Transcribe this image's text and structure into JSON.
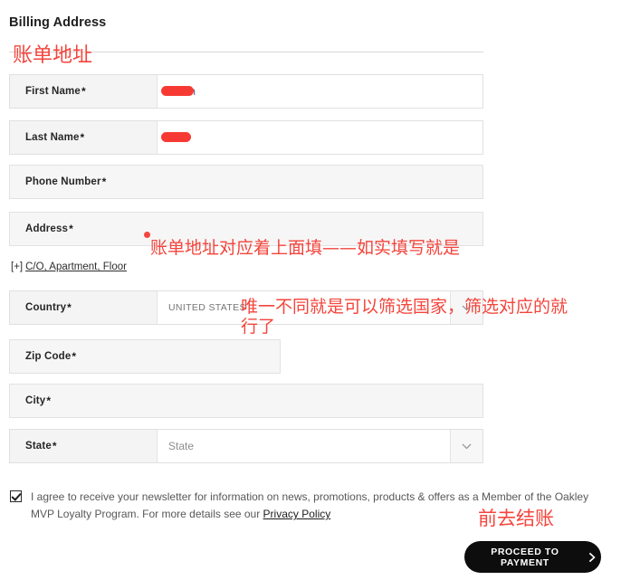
{
  "page": {
    "title": "Billing Address"
  },
  "annotations": [
    {
      "name": "annotation-billing-address",
      "text": "账单地址"
    },
    {
      "name": "annotation-address-note",
      "text": "账单地址对应着上面填——如实填写就是"
    },
    {
      "name": "annotation-country-note",
      "text": "唯一不同就是可以筛选国家，筛选对应的就\n行了"
    },
    {
      "name": "annotation-checkout-note",
      "text": "前去结账"
    }
  ],
  "form": {
    "required_marker": "*",
    "fields": [
      {
        "label": "First Name",
        "value": "",
        "placeholder": "",
        "redacted": true
      },
      {
        "label": "Last Name",
        "value": "",
        "placeholder": "",
        "redacted": true
      },
      {
        "label": "Phone Number",
        "value": "",
        "placeholder": "",
        "redacted": false
      },
      {
        "label": "Address",
        "value": "",
        "placeholder": "",
        "redacted": false
      },
      {
        "label": "Country",
        "value": "UNITED STATES",
        "placeholder": "",
        "redacted": false
      },
      {
        "label": "Zip Code",
        "value": "",
        "placeholder": "",
        "redacted": false
      },
      {
        "label": "City",
        "value": "",
        "placeholder": "",
        "redacted": false
      },
      {
        "label": "State",
        "value": "",
        "placeholder": "State",
        "redacted": false
      }
    ],
    "expand_link": {
      "prefix": "[+]",
      "label": "C/O, Apartment, Floor"
    }
  },
  "newsletter": {
    "checked": true,
    "text": "I agree to receive your newsletter for information on news, promotions, products & offers as a Member of the Oakley MVP Loyalty Program. For more details see our ",
    "link_label": "Privacy Policy"
  },
  "actions": {
    "proceed_label": "PROCEED TO PAYMENT"
  },
  "colors": {
    "annotation_red": "#f4453c",
    "button_background": "#0d0d0d",
    "label_background": "#f4f4f4"
  }
}
